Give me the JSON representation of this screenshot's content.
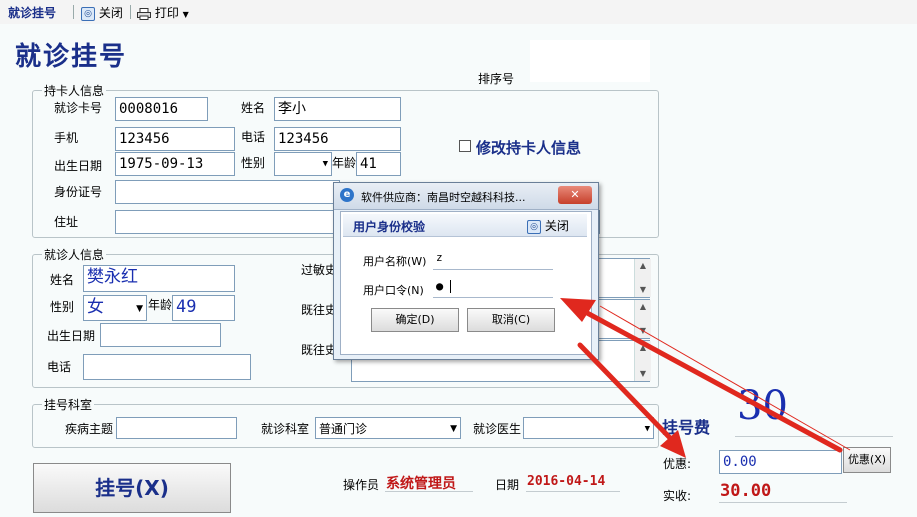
{
  "toolbar": {
    "title": "就诊挂号",
    "close_icon": "◎",
    "close_label": "关闭",
    "print_label": "打印"
  },
  "page": {
    "title": "就诊挂号",
    "serial_label": "排序号",
    "serial_value": ""
  },
  "cardholder": {
    "group_title": "持卡人信息",
    "card_no_label": "就诊卡号",
    "card_no": "0008016",
    "name_label": "姓名",
    "name": "李小",
    "phone_label": "手机",
    "phone": "123456",
    "tel_label": "电话",
    "tel": "123456",
    "birth_label": "出生日期",
    "birth": "1975-09-13",
    "gender_label": "性别",
    "gender": "",
    "age_label": "年龄",
    "age": "41",
    "id_label": "身份证号",
    "id": "",
    "address_label": "住址",
    "address": "",
    "modify_label": "修改持卡人信息"
  },
  "patient": {
    "group_title": "就诊人信息",
    "name_label": "姓名",
    "name": "樊永红",
    "gender_label": "性别",
    "gender": "女",
    "age_label": "年龄",
    "age": "49",
    "birth_label": "出生日期",
    "birth": "",
    "tel_label": "电话",
    "tel": "",
    "allergy_label": "过敏史",
    "history1_label": "既往史",
    "history2_label": "既往史"
  },
  "department": {
    "group_title": "挂号科室",
    "subject_label": "疾病主题",
    "subject": "",
    "dept_label": "就诊科室",
    "dept": "普通门诊",
    "doctor_label": "就诊医生",
    "doctor": ""
  },
  "fees": {
    "fee_label": "挂号费",
    "fee_value": "30",
    "discount_label": "优惠:",
    "discount_value": "0.00",
    "discount_button": "优惠(X)",
    "actual_label": "实收:",
    "actual_value": "30.00"
  },
  "footer": {
    "register_button": "挂号(X)",
    "operator_label": "操作员",
    "operator_value": "系统管理员",
    "date_label": "日期",
    "date_value": "2016-04-14"
  },
  "dialog": {
    "window_title": "软件供应商：南昌时空越科科技...",
    "window_close": "✕",
    "header": "用户身份校验",
    "close_label": "关闭",
    "username_label": "用户名称(W)",
    "username_value": "z",
    "password_label": "用户口令(N)",
    "password_value": "●",
    "ok_button": "确定(D)",
    "cancel_button": "取消(C)"
  },
  "colors": {
    "title_blue": "#1a2f8a",
    "value_red": "#c01818",
    "arrow_red": "#e0281e"
  }
}
